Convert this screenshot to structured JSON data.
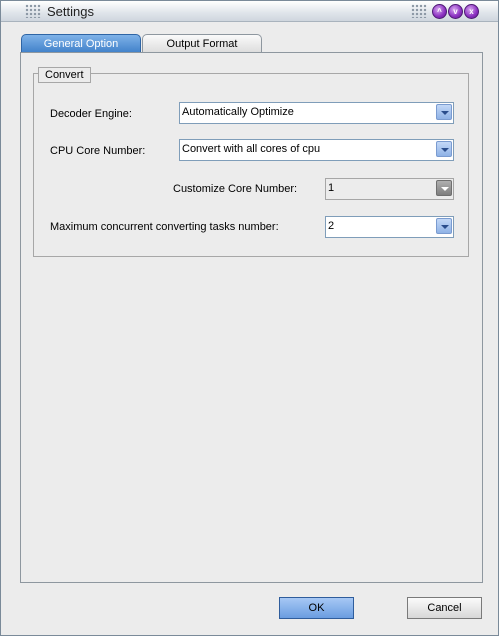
{
  "window": {
    "title": "Settings",
    "buttons": {
      "minimize": "^",
      "restore": "v",
      "close": "x"
    }
  },
  "tabs": [
    {
      "label": "General Option",
      "active": true
    },
    {
      "label": "Output Format",
      "active": false
    }
  ],
  "convert": {
    "group_title": "Convert",
    "decoder_engine": {
      "label": "Decoder Engine:",
      "value": "Automatically Optimize"
    },
    "cpu_core_number": {
      "label": "CPU Core Number:",
      "value": "Convert with all cores of cpu"
    },
    "customize_core_number": {
      "label": "Customize Core Number:",
      "value": "1",
      "enabled": false
    },
    "max_concurrent_tasks": {
      "label": "Maximum concurrent converting tasks number:",
      "value": "2"
    }
  },
  "footer": {
    "ok_label": "OK",
    "cancel_label": "Cancel"
  },
  "colors": {
    "accent": "#3f80c9",
    "window_bg": "#ececec",
    "title_button": "#8a2fc0"
  }
}
